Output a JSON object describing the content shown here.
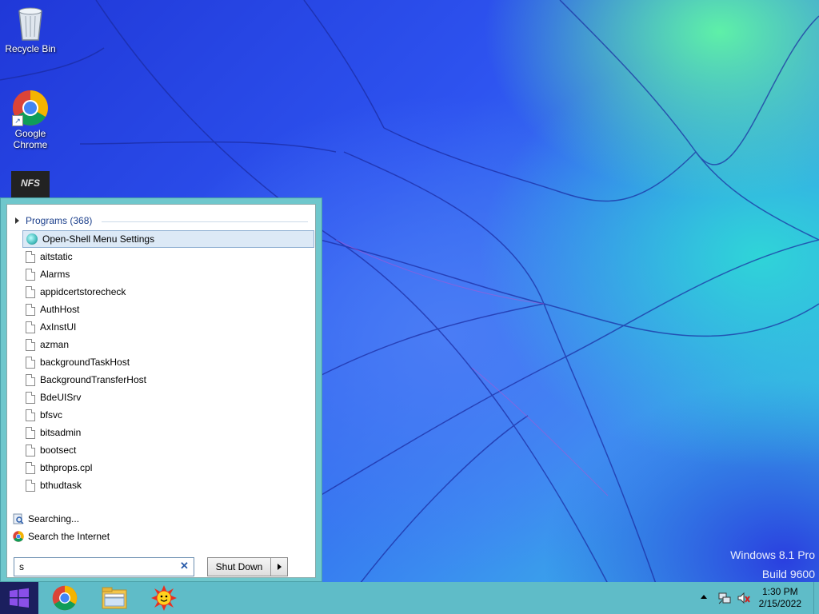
{
  "desktop": {
    "icons": [
      {
        "label": "Recycle Bin",
        "icon": "recycle-bin-icon"
      },
      {
        "label": "Google Chrome",
        "icon": "chrome-icon"
      },
      {
        "label": "",
        "icon": "nfs-game-icon"
      }
    ],
    "watermark": {
      "line1": "Windows 8.1 Pro",
      "line2": "Build 9600"
    }
  },
  "start_menu": {
    "programs_header": "Programs (368)",
    "items": [
      "Open-Shell Menu Settings",
      "aitstatic",
      "Alarms",
      "appidcertstorecheck",
      "AuthHost",
      "AxInstUI",
      "azman",
      "backgroundTaskHost",
      "BackgroundTransferHost",
      "BdeUISrv",
      "bfsvc",
      "bitsadmin",
      "bootsect",
      "bthprops.cpl",
      "bthudtask"
    ],
    "selected_index": 0,
    "searching_label": "Searching...",
    "search_internet_label": "Search the Internet",
    "search_value": "s",
    "clear_symbol": "✕",
    "shutdown_label": "Shut Down"
  },
  "taskbar": {
    "apps": [
      "chrome-icon",
      "file-explorer-icon",
      "sun-app-icon"
    ],
    "time": "1:30 PM",
    "date": "2/15/2022"
  }
}
